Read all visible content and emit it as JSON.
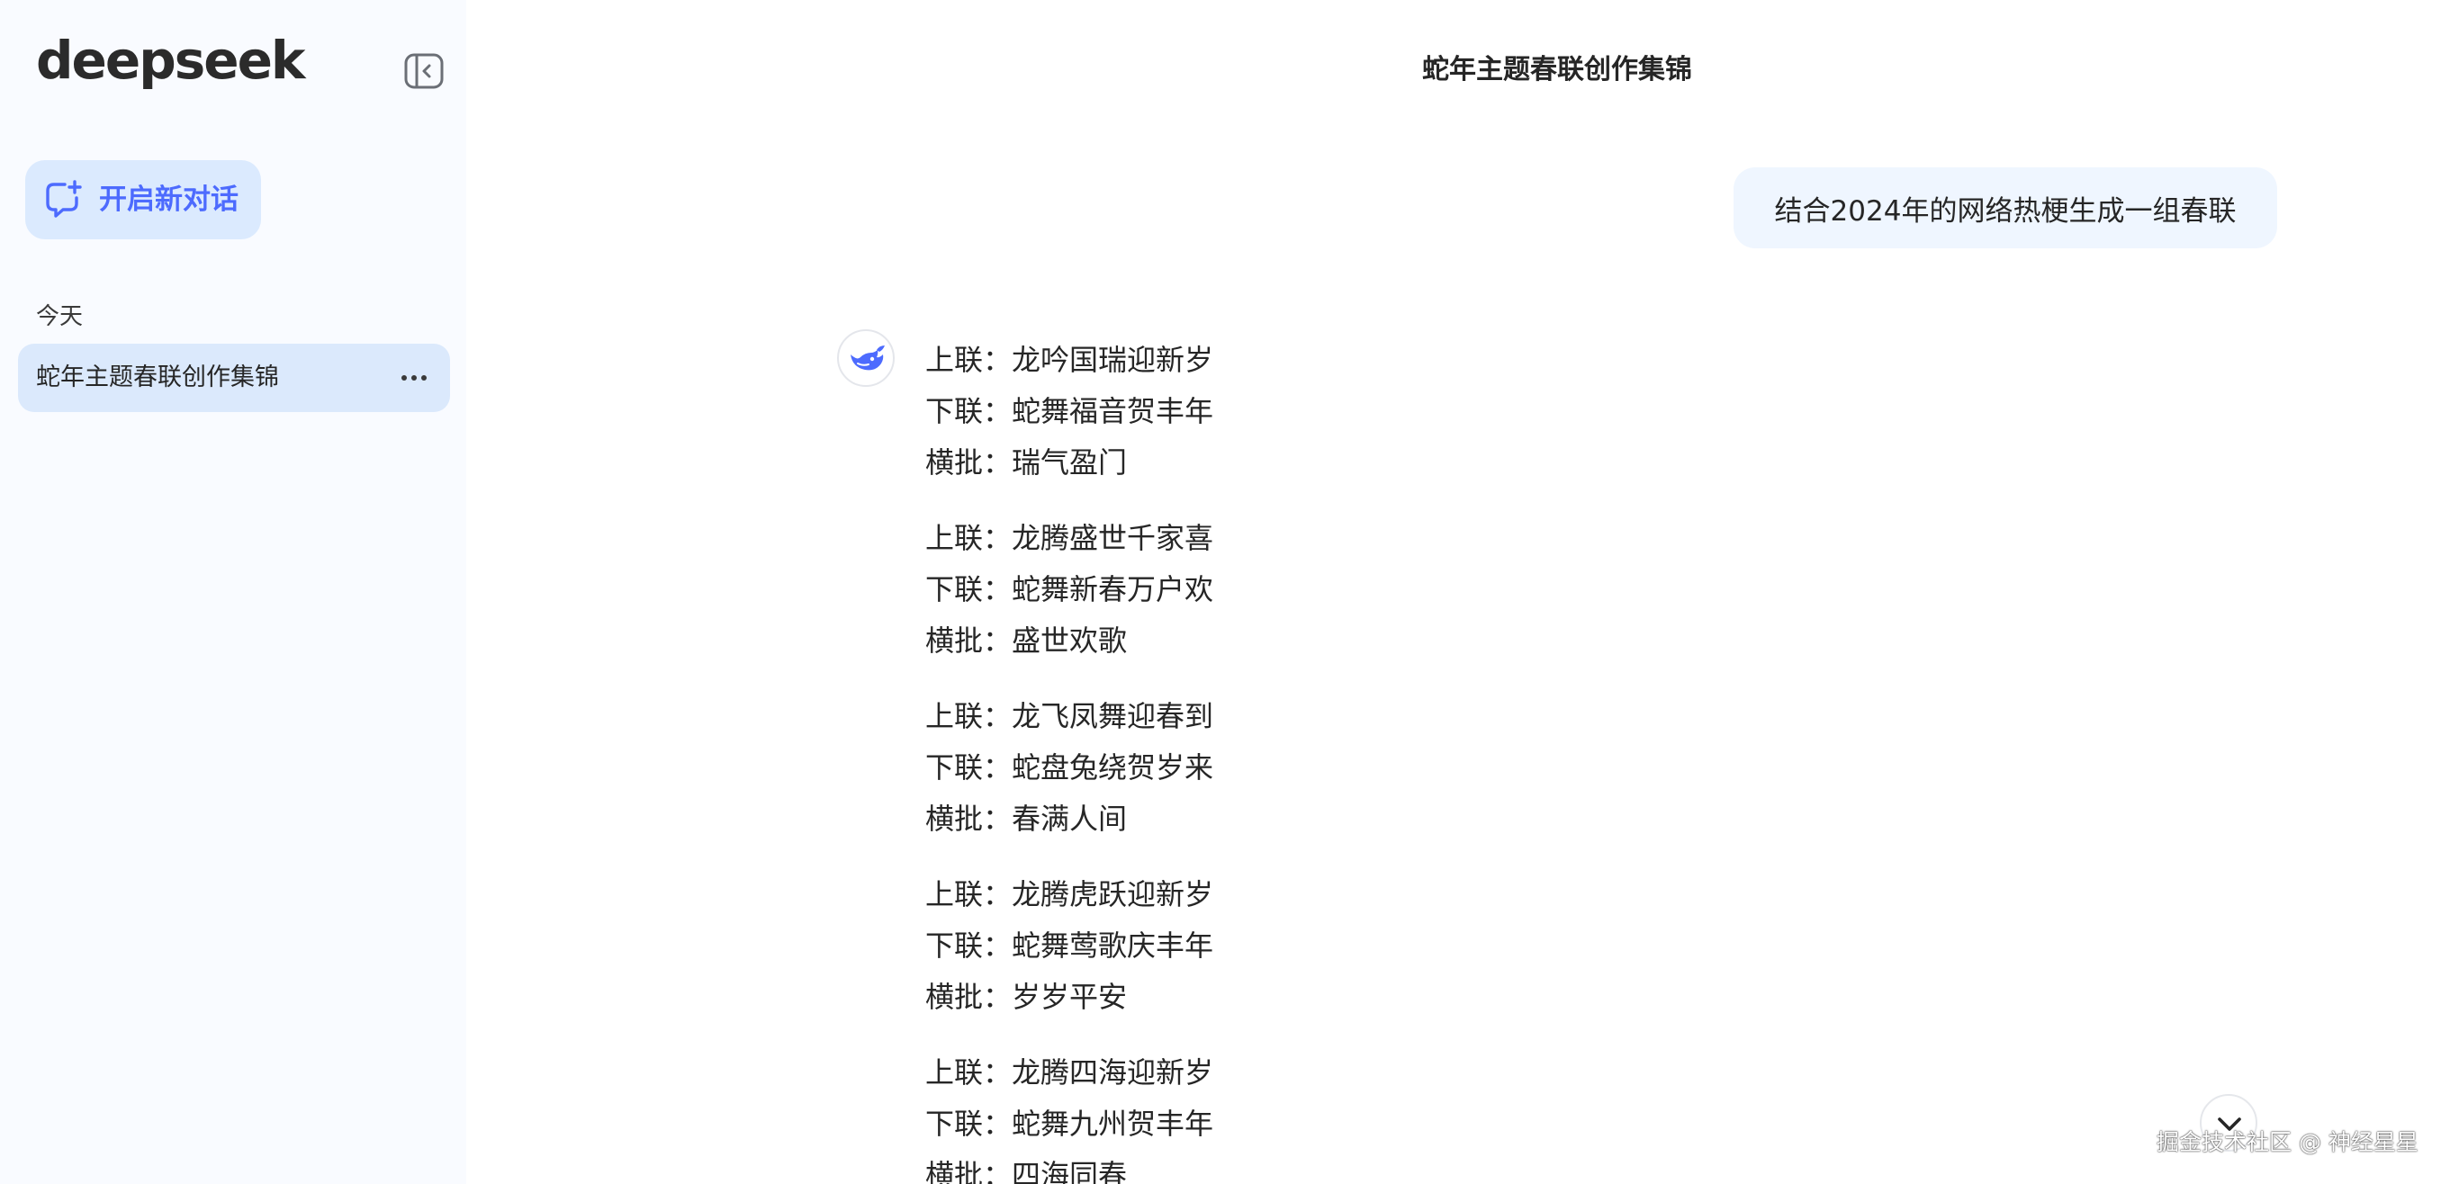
{
  "sidebar": {
    "logo_text": "deepseek",
    "new_chat_label": "开启新对话",
    "section_today": "今天",
    "history": [
      {
        "title": "蛇年主题春联创作集锦"
      }
    ]
  },
  "main": {
    "title": "蛇年主题春联创作集锦",
    "user_message": "结合2024年的网络热梗生成一组春联",
    "couplets": [
      {
        "upper": "上联：龙吟国瑞迎新岁",
        "lower": "下联：蛇舞福音贺丰年",
        "banner": "横批：瑞气盈门"
      },
      {
        "upper": "上联：龙腾盛世千家喜",
        "lower": "下联：蛇舞新春万户欢",
        "banner": "横批：盛世欢歌"
      },
      {
        "upper": "上联：龙飞凤舞迎春到",
        "lower": "下联：蛇盘兔绕贺岁来",
        "banner": "横批：春满人间"
      },
      {
        "upper": "上联：龙腾虎跃迎新岁",
        "lower": "下联：蛇舞莺歌庆丰年",
        "banner": "横批：岁岁平安"
      },
      {
        "upper": "上联：龙腾四海迎新岁",
        "lower": "下联：蛇舞九州贺丰年",
        "banner": "横批：四海同春"
      }
    ]
  },
  "watermark": "掘金技术社区 @ 神经星星",
  "colors": {
    "accent": "#4d6bfe",
    "sidebar_bg": "#f9fbff",
    "new_chat_bg": "#dbeafe",
    "history_active_bg": "#dbe9fc",
    "user_bubble_bg": "#eff6ff"
  },
  "icons": {
    "collapse": "sidebar-collapse-icon",
    "new_chat": "chat-plus-icon",
    "more": "more-horizontal-icon",
    "avatar": "deepseek-whale-icon",
    "scroll_down": "chevron-down-icon"
  }
}
